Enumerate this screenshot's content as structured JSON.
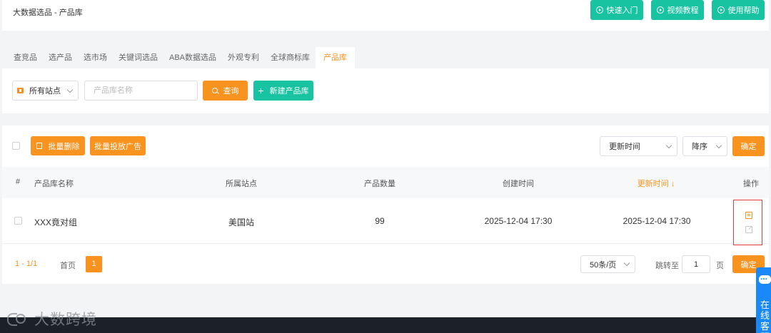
{
  "header": {
    "breadcrumb": "大数据选品 - 产品库",
    "buttons": [
      {
        "label": "快速入门",
        "icon": "play-circle-icon"
      },
      {
        "label": "视频教程",
        "icon": "play-circle-icon"
      },
      {
        "label": "使用帮助",
        "icon": "help-circle-icon"
      }
    ]
  },
  "tabs": [
    "查竞品",
    "选产品",
    "选市场",
    "关键词选品",
    "ABA数据选品",
    "外观专利",
    "全球商标库",
    "产品库"
  ],
  "active_tab": "产品库",
  "filter": {
    "site_select": "所有站点",
    "name_placeholder": "产品库名称",
    "search_label": "查询",
    "new_label": "新建产品库"
  },
  "toolbar": {
    "batch_delete": "批量删除",
    "batch_ads": "批量投放广告",
    "sort_field": "更新时间",
    "sort_order": "降序",
    "confirm": "确定"
  },
  "table": {
    "headers": {
      "index": "#",
      "name": "产品库名称",
      "site": "所属站点",
      "count": "产品数量",
      "created": "创建时间",
      "updated": "更新时间 ↓",
      "actions": "操作"
    },
    "rows": [
      {
        "name": "XXX竟对组",
        "site": "美国站",
        "count": "99",
        "created": "2025-12-04 17:30",
        "updated": "2025-12-04 17:30"
      }
    ]
  },
  "pager": {
    "range": "1 - 1/1",
    "first": "首页",
    "current": "1",
    "page_size": "50条/页",
    "jump_label": "跳转至",
    "jump_value": "1",
    "page_unit": "页",
    "confirm": "确定"
  },
  "footer": {
    "brand": "大数跨境"
  },
  "chat": {
    "label": "在线客服"
  },
  "colors": {
    "orange": "#f7931e",
    "green": "#17c3a0",
    "highlight": "#e03a3a",
    "chat_blue": "#1989fa"
  }
}
